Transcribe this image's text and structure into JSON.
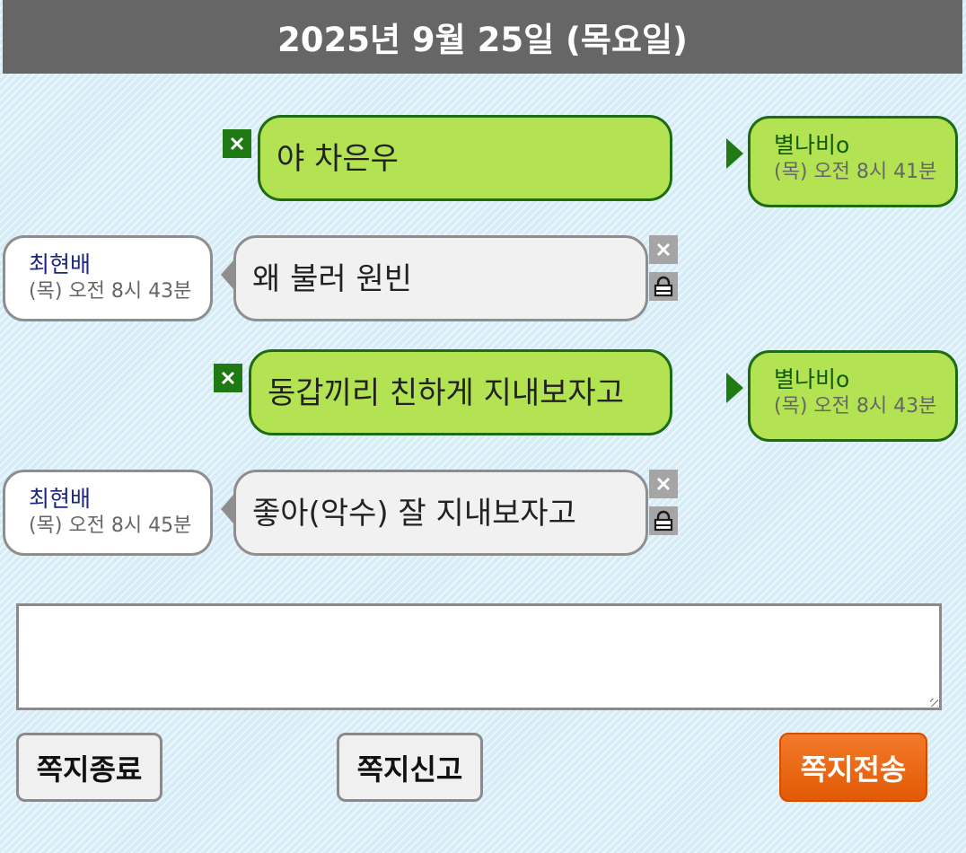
{
  "header": {
    "date": "2025년 9월 25일 (목요일)"
  },
  "messages": [
    {
      "direction": "sent",
      "text": "야 차은우",
      "sender": "별나비o",
      "time": "(목) 오전 8시 41분"
    },
    {
      "direction": "received",
      "text": "왜 불러 원빈",
      "sender": "최현배",
      "time": "(목) 오전 8시 43분"
    },
    {
      "direction": "sent",
      "text": "동갑끼리 친하게 지내보자고",
      "sender": "별나비o",
      "time": "(목) 오전 8시 43분"
    },
    {
      "direction": "received",
      "text": "좋아(악수) 잘 지내보자고",
      "sender": "최현배",
      "time": "(목) 오전 8시 45분"
    }
  ],
  "composer": {
    "value": "",
    "placeholder": ""
  },
  "buttons": {
    "close_label": "쪽지종료",
    "report_label": "쪽지신고",
    "send_label": "쪽지전송"
  },
  "icons": {
    "delete": "close-icon",
    "block": "lock-icon"
  },
  "colors": {
    "header_bg": "#666666",
    "sent_bubble": "#b3e352",
    "sent_border": "#1d6c13",
    "received_bubble": "#f1f1f1",
    "received_border": "#8e8e8e",
    "send_button": "#e9620e"
  }
}
